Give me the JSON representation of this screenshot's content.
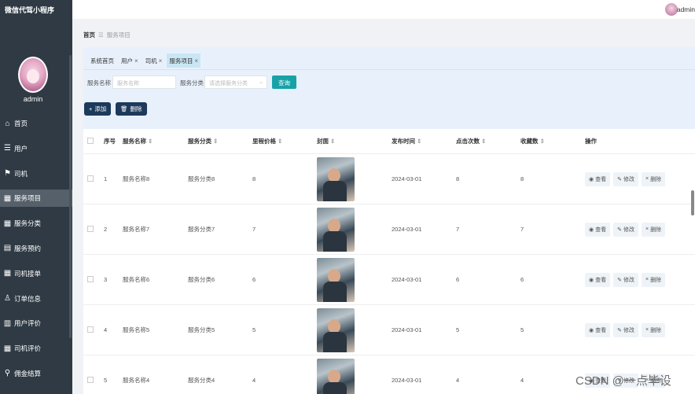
{
  "app": {
    "title": "微信代驾小程序",
    "user": "admin"
  },
  "sidebar": {
    "items": [
      {
        "label": "首页",
        "icon": "home-icon",
        "glyph": "⌂"
      },
      {
        "label": "用户",
        "icon": "list-icon",
        "glyph": "☰"
      },
      {
        "label": "司机",
        "icon": "flag-icon",
        "glyph": "⚑"
      },
      {
        "label": "服务项目",
        "icon": "grid-icon",
        "glyph": "▦",
        "active": true
      },
      {
        "label": "服务分类",
        "icon": "grid-icon",
        "glyph": "▦"
      },
      {
        "label": "服务预约",
        "icon": "clipboard-icon",
        "glyph": "▤"
      },
      {
        "label": "司机接单",
        "icon": "grid-icon",
        "glyph": "▦"
      },
      {
        "label": "订单信息",
        "icon": "user-icon",
        "glyph": "♙"
      },
      {
        "label": "用户评价",
        "icon": "chart-icon",
        "glyph": "▥"
      },
      {
        "label": "司机评价",
        "icon": "grid-icon",
        "glyph": "▦"
      },
      {
        "label": "佣金结算",
        "icon": "pin-icon",
        "glyph": "⚲"
      }
    ]
  },
  "breadcrumb": {
    "home": "首页",
    "sep": "☰",
    "current": "服务项目"
  },
  "tabs": [
    {
      "label": "系统首页",
      "closable": false
    },
    {
      "label": "用户",
      "closable": true
    },
    {
      "label": "司机",
      "closable": true
    },
    {
      "label": "服务项目",
      "closable": true,
      "active": true
    }
  ],
  "search": {
    "name_label": "服务名称",
    "name_placeholder": "服务名称",
    "category_label": "服务分类",
    "category_placeholder": "请选择服务分类",
    "query_button": "查询"
  },
  "toolbar": {
    "add_label": "添加",
    "delete_label": "删除"
  },
  "table": {
    "headers": {
      "index": "序号",
      "name": "服务名称",
      "category": "服务分类",
      "price": "里程价格",
      "cover": "封面",
      "date": "发布时间",
      "clicks": "点击次数",
      "favorites": "收藏数",
      "actions": "操作"
    },
    "actions": {
      "view": "查看",
      "edit": "修改",
      "delete": "删除"
    },
    "rows": [
      {
        "index": "1",
        "name": "服务名称8",
        "category": "服务分类8",
        "price": "8",
        "date": "2024-03-01",
        "clicks": "8",
        "favorites": "8"
      },
      {
        "index": "2",
        "name": "服务名称7",
        "category": "服务分类7",
        "price": "7",
        "date": "2024-03-01",
        "clicks": "7",
        "favorites": "7"
      },
      {
        "index": "3",
        "name": "服务名称6",
        "category": "服务分类6",
        "price": "6",
        "date": "2024-03-01",
        "clicks": "6",
        "favorites": "6"
      },
      {
        "index": "4",
        "name": "服务名称5",
        "category": "服务分类5",
        "price": "5",
        "date": "2024-03-01",
        "clicks": "5",
        "favorites": "5"
      },
      {
        "index": "5",
        "name": "服务名称4",
        "category": "服务分类4",
        "price": "4",
        "date": "2024-03-01",
        "clicks": "4",
        "favorites": "4"
      }
    ]
  },
  "watermark": "CSDN @一点毕设",
  "colors": {
    "sidebar_bg": "#2f3a44",
    "accent": "#17a2a8",
    "button_dark": "#1d3a5c",
    "panel_bg": "#e8f1fb"
  }
}
